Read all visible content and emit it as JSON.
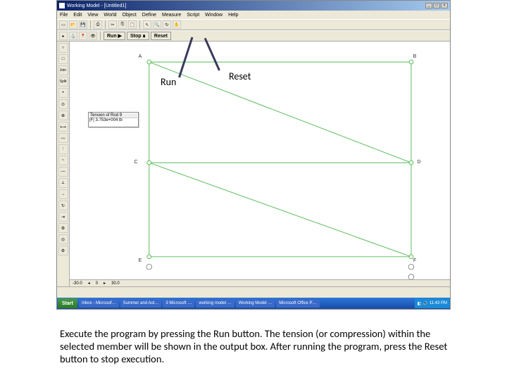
{
  "window": {
    "title": "Working Model - [Untitled1]",
    "min": "_",
    "max": "□",
    "close": "×"
  },
  "menu": [
    "File",
    "Edit",
    "View",
    "World",
    "Object",
    "Define",
    "Measure",
    "Script",
    "Window",
    "Help"
  ],
  "toolbar2": {
    "run": "Run ▶",
    "stop": "Stop ∎",
    "reset": "Reset"
  },
  "output_box": {
    "title": "Tension of Rod 9",
    "value": "|F| 3.753e+004 lb"
  },
  "nodes": {
    "A": "A",
    "B": "B",
    "C": "C",
    "D": "D",
    "E": "E",
    "F": "F"
  },
  "ruler": {
    "neg": "-30.0",
    "zero": "0",
    "pos": "30.0"
  },
  "taskbar": {
    "start": "Start",
    "items": [
      "Inbox - Microsof…",
      "Summer and Aut…",
      "3 Microsoft …",
      "working model …",
      "Working Model …",
      "Microsoft Office P…"
    ],
    "clock": "11:43 PM"
  },
  "callouts": {
    "run": "Run",
    "reset": "Reset"
  },
  "caption": "Execute the program by pressing the Run button. The tension (or compression) within the selected member will be shown in the output box. After running the program, press the Reset button to stop execution."
}
